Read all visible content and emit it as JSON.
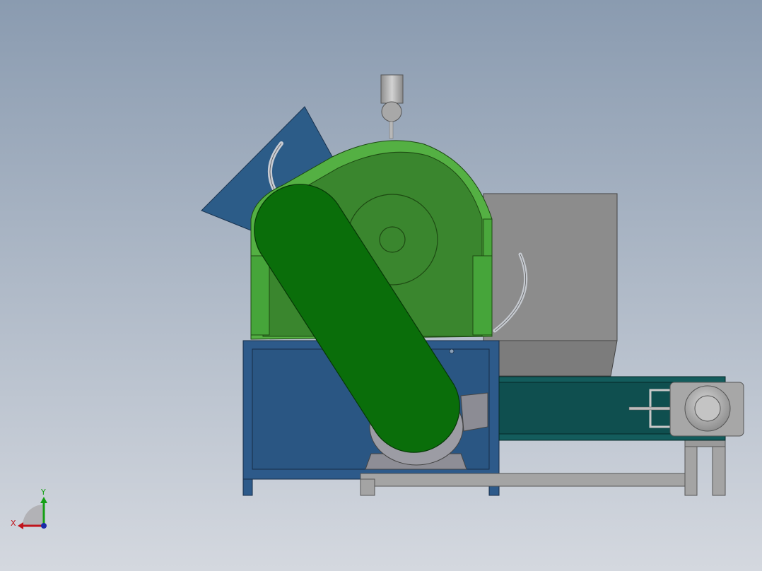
{
  "viewport": {
    "background_top": "#8a9bb0",
    "background_bottom": "#d4d8df"
  },
  "model": {
    "parts": {
      "feed_hopper": "#2c5c88",
      "crusher_housing": "#3a862e",
      "housing_rim": "#54b043",
      "belt_guard": "#0a6e0a",
      "base_frame": "#2d5a8a",
      "discharge_chute": "#8c8c8c",
      "conveyor": "#0f4f4f",
      "conveyor_stand": "#a4a4a4",
      "motor": "#a7a7a7",
      "top_cylinder": "#b2b2b2"
    }
  },
  "triad": {
    "x_label": "X",
    "y_label": "Y",
    "x_color": "#c0141c",
    "y_color": "#14a014",
    "z_color": "#1a2aa8"
  }
}
